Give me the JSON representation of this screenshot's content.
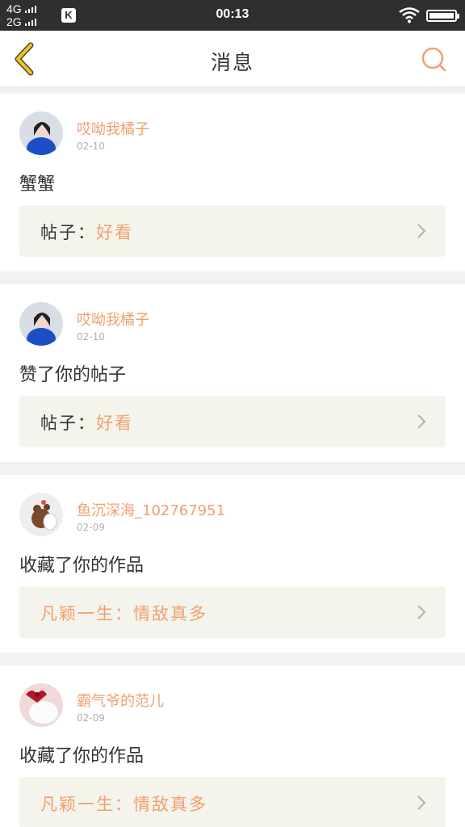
{
  "status_bar": {
    "net1": "4G",
    "net2": "2G",
    "app_badge": "K",
    "time": "00:13"
  },
  "header": {
    "title": "消息",
    "back_icon": "chevron-left-icon",
    "search_icon": "search-icon"
  },
  "messages": [
    {
      "user": "哎呦我橘子",
      "date": "02-10",
      "content": "蟹蟹",
      "ref_prefix": "帖子：",
      "ref_title": "好看",
      "ref_full": ""
    },
    {
      "user": "哎呦我橘子",
      "date": "02-10",
      "content": "赞了你的帖子",
      "ref_prefix": "帖子：",
      "ref_title": "好看",
      "ref_full": ""
    },
    {
      "user": "鱼沉深海_102767951",
      "date": "02-09",
      "content": "收藏了你的作品",
      "ref_prefix": "",
      "ref_title": "",
      "ref_full": "凡颖一生：情敌真多"
    },
    {
      "user": "霸气爷的范儿",
      "date": "02-09",
      "content": "收藏了你的作品",
      "ref_prefix": "",
      "ref_title": "",
      "ref_full": "凡颖一生：情敌真多"
    }
  ],
  "colors": {
    "accent": "#f0a070",
    "back_icon": "#f5c518",
    "status_bar": "#2f2f2f"
  }
}
